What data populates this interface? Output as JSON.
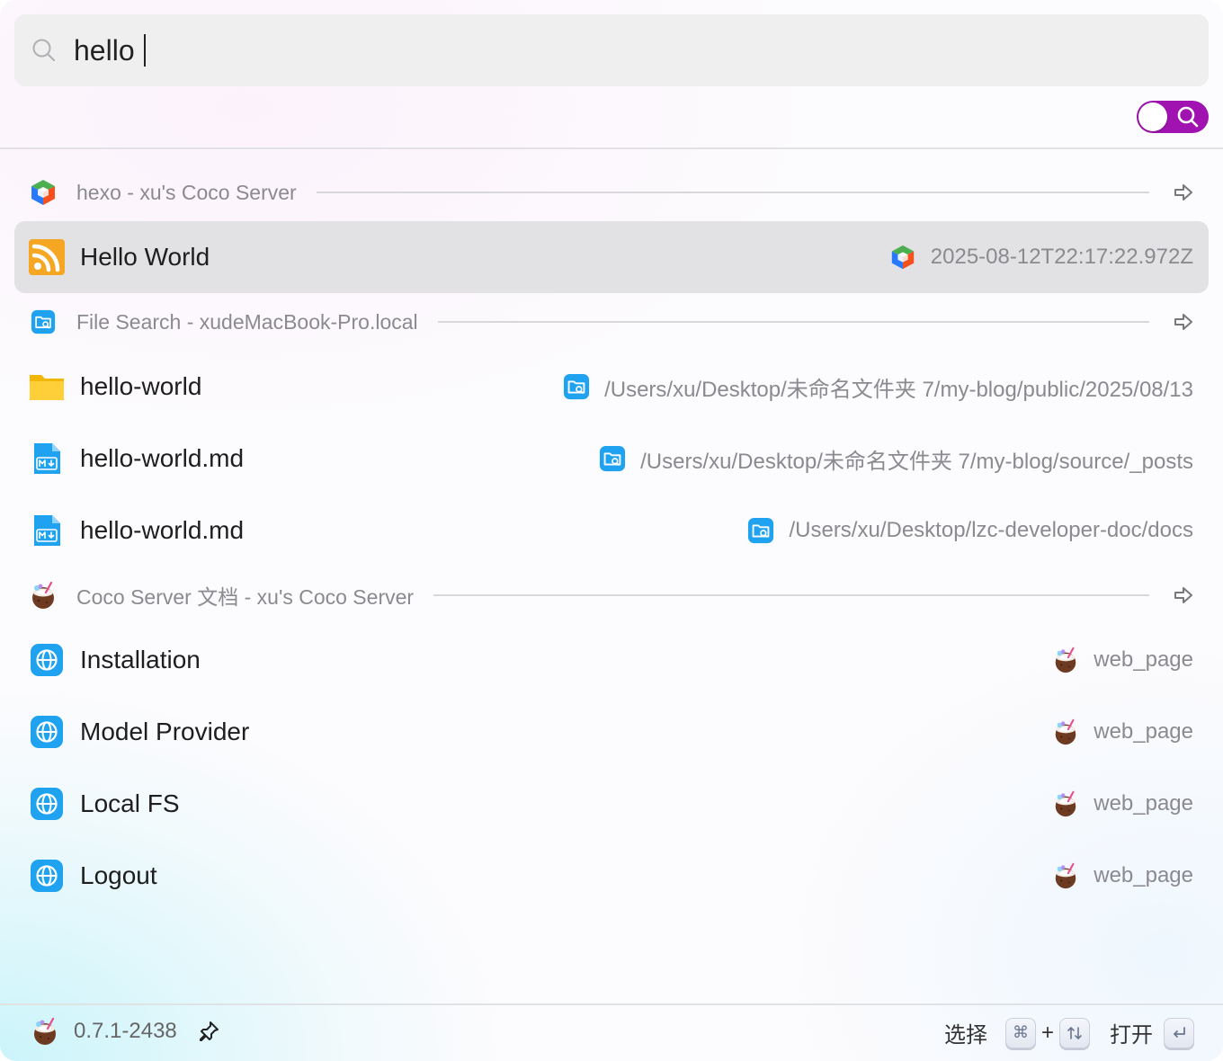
{
  "search": {
    "query": "hello"
  },
  "groups": [
    {
      "title": "hexo - xu's Coco Server",
      "icon": "coco-server-cube-icon"
    },
    {
      "title": "File Search - xudeMacBook-Pro.local",
      "icon": "file-search-icon"
    },
    {
      "title": "Coco Server 文档 - xu's Coco Server",
      "icon": "coconut-icon"
    }
  ],
  "results": [
    {
      "title": "Hello World",
      "icon": "rss-icon",
      "meta_icon": "coco-server-cube-icon",
      "meta": "2025-08-12T22:17:22.972Z",
      "selected": true
    },
    {
      "title": "hello-world",
      "icon": "folder-icon",
      "meta_icon": "file-search-icon",
      "meta": "/Users/xu/Desktop/未命名文件夹 7/my-blog/public/2025/08/13"
    },
    {
      "title": "hello-world.md",
      "icon": "markdown-file-icon",
      "meta_icon": "file-search-icon",
      "meta": "/Users/xu/Desktop/未命名文件夹 7/my-blog/source/_posts"
    },
    {
      "title": "hello-world.md",
      "icon": "markdown-file-icon",
      "meta_icon": "file-search-icon",
      "meta": "/Users/xu/Desktop/lzc-developer-doc/docs"
    },
    {
      "title": "Installation",
      "icon": "globe-icon",
      "meta_icon": "coconut-icon",
      "meta": "web_page"
    },
    {
      "title": "Model Provider",
      "icon": "globe-icon",
      "meta_icon": "coconut-icon",
      "meta": "web_page"
    },
    {
      "title": "Local FS",
      "icon": "globe-icon",
      "meta_icon": "coconut-icon",
      "meta": "web_page"
    },
    {
      "title": "Logout",
      "icon": "globe-icon",
      "meta_icon": "coconut-icon",
      "meta": "web_page"
    }
  ],
  "footer": {
    "version": "0.7.1-2438",
    "select_label": "选择",
    "cmd_key": "⌘",
    "plus": "+",
    "open_label": "打开"
  },
  "colors": {
    "toggle": "#a013b0",
    "selected_row": "#e2e2e4",
    "search_bg": "#efefef",
    "rss": "#f5a623",
    "blue_icon": "#1fa3f0"
  }
}
